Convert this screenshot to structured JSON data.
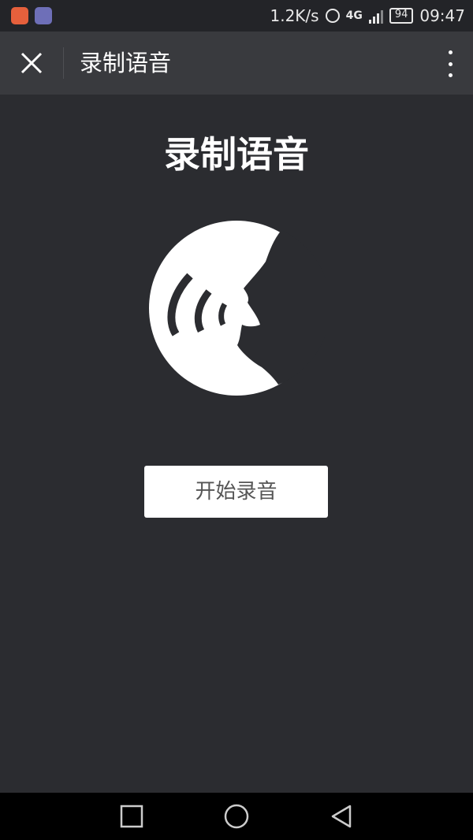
{
  "status_bar": {
    "net_speed": "1.2K/s",
    "network_type": "4G",
    "battery_level": "94",
    "time": "09:47",
    "icons": [
      "app-notification-icon",
      "gallery-notification-icon",
      "alarm-icon",
      "signal-icon",
      "battery-icon"
    ]
  },
  "header": {
    "title": "录制语音",
    "close_icon": "close-icon",
    "more_icon": "more-vertical-icon"
  },
  "main": {
    "title": "录制语音",
    "illustration": "speaking-head-icon",
    "record_button_label": "开始录音"
  },
  "nav_bar": {
    "icons": [
      "recent-apps-icon",
      "home-icon",
      "back-icon"
    ]
  },
  "colors": {
    "background": "#2b2c30",
    "header_bg": "#393a3e",
    "status_bg": "#232428",
    "button_bg": "#ffffff"
  }
}
